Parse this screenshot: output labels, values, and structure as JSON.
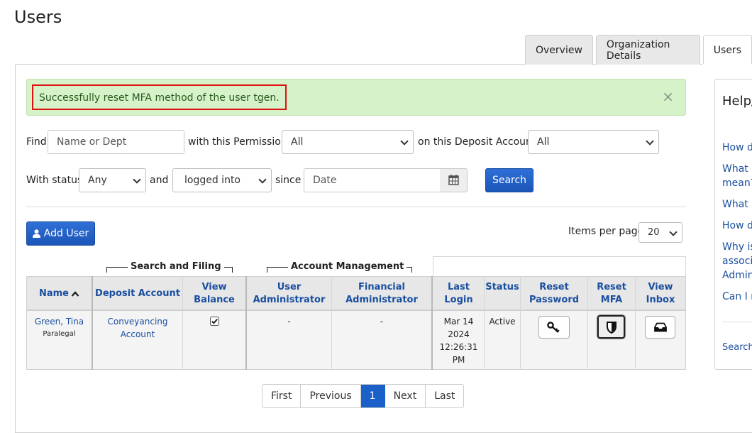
{
  "page_title": "Users",
  "tabs": [
    {
      "label": "Overview"
    },
    {
      "label": "Organization Details"
    },
    {
      "label": "Users",
      "active": true
    }
  ],
  "alert": {
    "message": "Successfully reset MFA method of the user tgen.",
    "close": "×"
  },
  "filters": {
    "find_label": "Find",
    "find_placeholder": "Name or Dept",
    "permission_label": "with this Permission",
    "permission_value": "All",
    "deposit_label": "on this Deposit Account",
    "deposit_value": "All",
    "status_label": "With status",
    "status_value": "Any",
    "and_label": "and",
    "login_value": "logged into",
    "since_label": "since",
    "date_placeholder": "Date",
    "search_button": "Search"
  },
  "add_user_button": "Add User",
  "items_per_page": {
    "label": "Items per page",
    "value": "20"
  },
  "table": {
    "groups": {
      "search_filing": "Search and Filing",
      "account_mgmt": "Account Management"
    },
    "headers": {
      "name": "Name",
      "deposit_account": "Deposit Account",
      "view_balance": "View Balance",
      "user_admin": "User Administrator",
      "financial_admin": "Financial Administrator",
      "last_login": "Last Login",
      "status": "Status",
      "reset_password": "Reset Password",
      "reset_mfa": "Reset MFA",
      "view_inbox": "View Inbox"
    },
    "sort_indicator": "up",
    "rows": [
      {
        "name": "Green, Tina",
        "role": "Paralegal",
        "deposit_account": "Conveyancing Account",
        "view_balance": true,
        "user_admin": "-",
        "financial_admin": "-",
        "last_login_date": "Mar 14",
        "last_login_year": "2024",
        "last_login_time": "12:26:31",
        "last_login_ampm": "PM",
        "status": "Active"
      }
    ]
  },
  "pagination": {
    "first": "First",
    "previous": "Previous",
    "current": "1",
    "next": "Next",
    "last": "Last"
  },
  "help": {
    "title": "Help/",
    "links": [
      "How do",
      "What d",
      "mean?",
      "What a",
      "How do",
      "Why is",
      "associ",
      "Admini",
      "Can I r"
    ],
    "search": "Search"
  },
  "colors": {
    "primary": "#1b5fc8",
    "alert_bg": "#d5f2c8",
    "link": "#1a4fa0",
    "alert_border": "#e01010"
  }
}
